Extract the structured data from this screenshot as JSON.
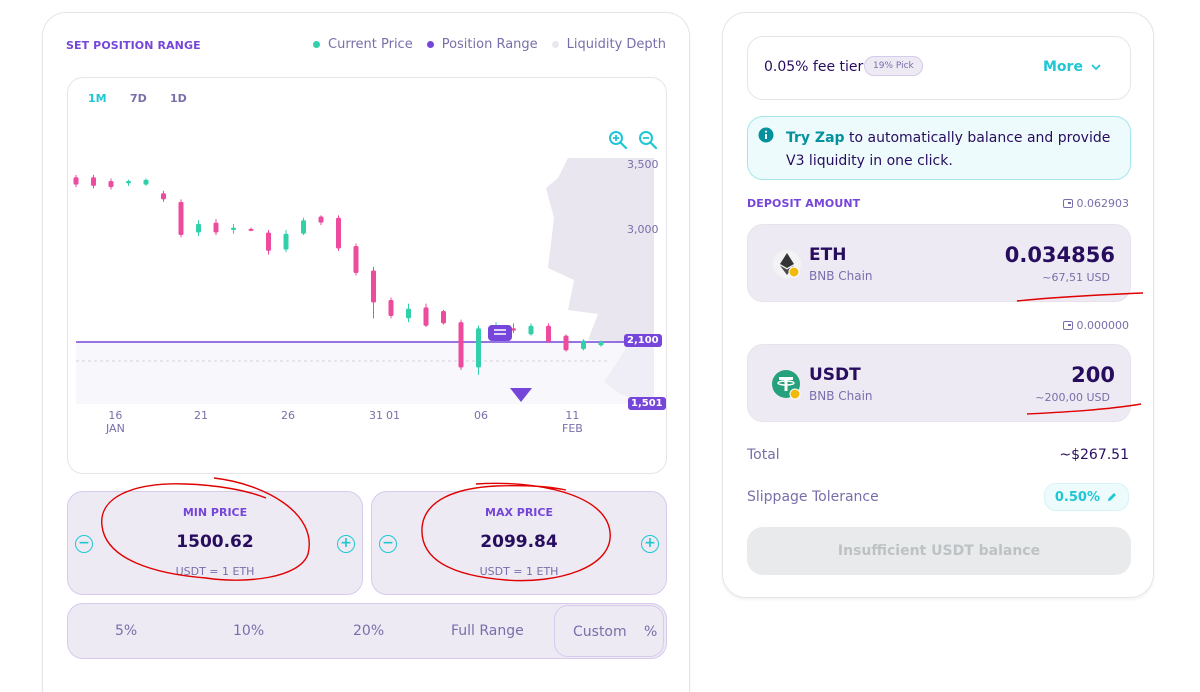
{
  "position_range": {
    "title": "SET POSITION RANGE",
    "legend": [
      {
        "label": "Current Price",
        "color": "#31d0aa"
      },
      {
        "label": "Position Range",
        "color": "#7645d9"
      },
      {
        "label": "Liquidity Depth",
        "color": "#e9e6ef"
      }
    ],
    "timeframes": [
      {
        "label": "1M",
        "active": true
      },
      {
        "label": "7D",
        "active": false
      },
      {
        "label": "1D",
        "active": false
      }
    ],
    "zoom_in_icon": "zoom-in-icon",
    "zoom_out_icon": "zoom-out-icon"
  },
  "chart_data": {
    "type": "candlestick",
    "y_ticks": [
      "3,500",
      "3,000"
    ],
    "ylim": [
      1450,
      3650
    ],
    "current_price_marker": "2,100",
    "min_price_marker": "1,501",
    "x_ticks": [
      {
        "day": "16",
        "month": "JAN"
      },
      {
        "day": "21",
        "month": ""
      },
      {
        "day": "26",
        "month": ""
      },
      {
        "day": "31",
        "month": ""
      },
      {
        "day": "01",
        "month": ""
      },
      {
        "day": "06",
        "month": ""
      },
      {
        "day": "11",
        "month": "FEB"
      }
    ],
    "candles": [
      {
        "o": 3330,
        "c": 3270,
        "h": 3350,
        "l": 3250
      },
      {
        "o": 3330,
        "c": 3260,
        "h": 3350,
        "l": 3240
      },
      {
        "o": 3300,
        "c": 3250,
        "h": 3320,
        "l": 3230
      },
      {
        "o": 3280,
        "c": 3300,
        "h": 3310,
        "l": 3260
      },
      {
        "o": 3270,
        "c": 3310,
        "h": 3320,
        "l": 3260
      },
      {
        "o": 3200,
        "c": 3150,
        "h": 3220,
        "l": 3130
      },
      {
        "o": 3130,
        "c": 2860,
        "h": 3150,
        "l": 2840
      },
      {
        "o": 2880,
        "c": 2950,
        "h": 2980,
        "l": 2850
      },
      {
        "o": 2960,
        "c": 2880,
        "h": 2990,
        "l": 2860
      },
      {
        "o": 2900,
        "c": 2920,
        "h": 2950,
        "l": 2870
      },
      {
        "o": 2910,
        "c": 2900,
        "h": 2920,
        "l": 2890
      },
      {
        "o": 2880,
        "c": 2730,
        "h": 2900,
        "l": 2700
      },
      {
        "o": 2740,
        "c": 2870,
        "h": 2900,
        "l": 2720
      },
      {
        "o": 2870,
        "c": 2980,
        "h": 3000,
        "l": 2860
      },
      {
        "o": 3010,
        "c": 2960,
        "h": 3020,
        "l": 2940
      },
      {
        "o": 3000,
        "c": 2750,
        "h": 3020,
        "l": 2730
      },
      {
        "o": 2770,
        "c": 2550,
        "h": 2790,
        "l": 2530
      },
      {
        "o": 2570,
        "c": 2310,
        "h": 2600,
        "l": 2180
      },
      {
        "o": 2330,
        "c": 2200,
        "h": 2350,
        "l": 2180
      },
      {
        "o": 2180,
        "c": 2260,
        "h": 2300,
        "l": 2150
      },
      {
        "o": 2270,
        "c": 2120,
        "h": 2300,
        "l": 2110
      },
      {
        "o": 2240,
        "c": 2140,
        "h": 2250,
        "l": 2130
      },
      {
        "o": 2150,
        "c": 1780,
        "h": 2170,
        "l": 1760
      },
      {
        "o": 1780,
        "c": 2100,
        "h": 2120,
        "l": 1720
      },
      {
        "o": 2050,
        "c": 2120,
        "h": 2150,
        "l": 2040
      },
      {
        "o": 2100,
        "c": 2080,
        "h": 2140,
        "l": 2060
      },
      {
        "o": 2050,
        "c": 2120,
        "h": 2140,
        "l": 2040
      },
      {
        "o": 2120,
        "c": 1990,
        "h": 2140,
        "l": 1980
      },
      {
        "o": 2040,
        "c": 1920,
        "h": 2050,
        "l": 1910
      },
      {
        "o": 1930,
        "c": 2000,
        "h": 2010,
        "l": 1920
      },
      {
        "o": 1960,
        "c": 1990,
        "h": 2000,
        "l": 1950
      }
    ]
  },
  "min_price": {
    "label": "MIN PRICE",
    "value": "1500.62",
    "unit": "USDT = 1 ETH"
  },
  "max_price": {
    "label": "MAX PRICE",
    "value": "2099.84",
    "unit": "USDT = 1 ETH"
  },
  "range_options": [
    "5%",
    "10%",
    "20%",
    "Full Range",
    "Custom",
    "%"
  ],
  "fee": {
    "label": "0.05% fee tier",
    "badge": "19% Pick",
    "more": "More"
  },
  "zap": {
    "link": "Try Zap",
    "text": " to automatically balance and provide V3 liquidity in one click."
  },
  "deposit": {
    "title": "DEPOSIT AMOUNT",
    "tokens": [
      {
        "symbol": "ETH",
        "chain": "BNB Chain",
        "amount": "0.034856",
        "usd": "~67,51 USD",
        "balance": "0.062903",
        "color": "#627eea"
      },
      {
        "symbol": "USDT",
        "chain": "BNB Chain",
        "amount": "200",
        "usd": "~200,00 USD",
        "balance": "0.000000",
        "color": "#26a17b"
      }
    ]
  },
  "summary": {
    "total_label": "Total",
    "total_value": "~$267.51",
    "slippage_label": "Slippage Tolerance",
    "slippage_value": "0.50%"
  },
  "submit": {
    "label": "Insufficient USDT balance"
  },
  "colors": {
    "accent": "#1fc7d4",
    "primary": "#7645d9",
    "up": "#31d0aa",
    "down": "#ed4b9e",
    "text": "#280d5f",
    "annotation": "#e00000"
  }
}
